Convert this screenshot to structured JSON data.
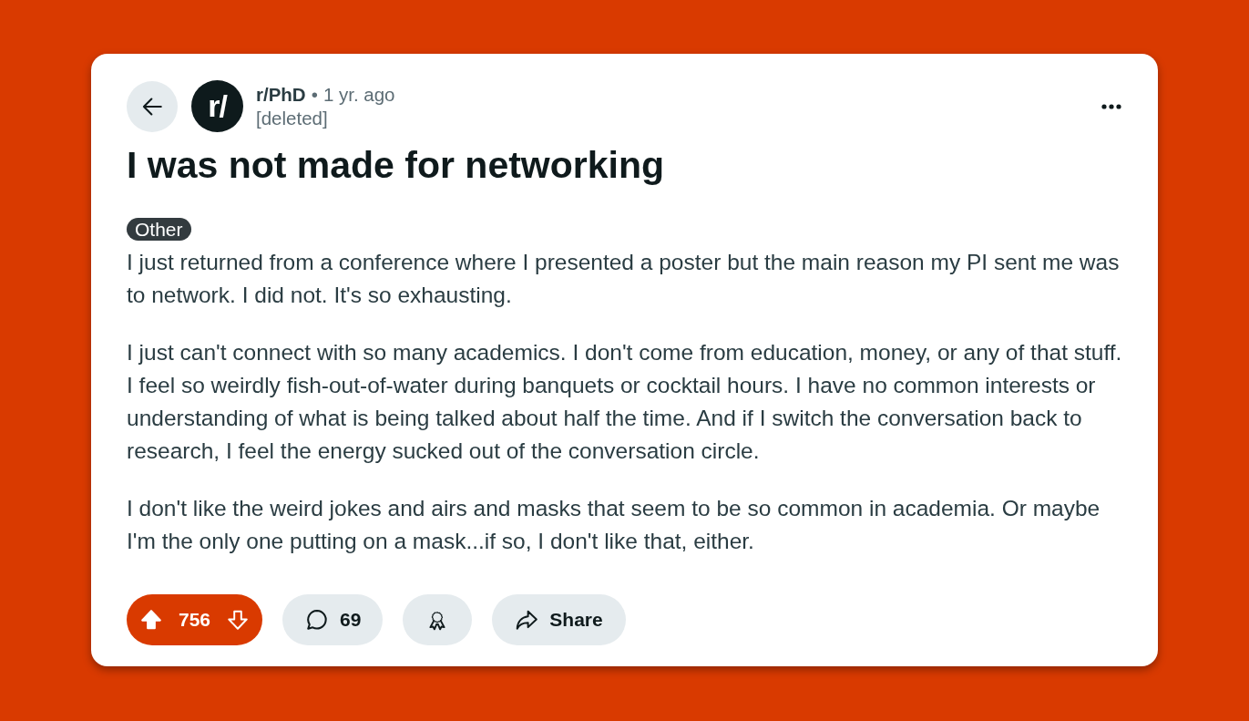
{
  "post": {
    "community": {
      "avatar_text": "r/",
      "name": "r/PhD"
    },
    "separator": "•",
    "age": "1 yr. ago",
    "author": "[deleted]",
    "title": "I was not made for networking",
    "flair": "Other",
    "body": [
      "I just returned from a conference where I presented a poster but the main reason my PI sent me was to network. I did not. It's so exhausting.",
      "I just can't connect with so many academics. I don't come from education, money, or any of that stuff. I feel so weirdly fish-out-of-water during banquets or cocktail hours. I have no common interests or understanding of what is being talked about half the time. And if I switch the conversation back to research, I feel the energy sucked out of the conversation circle.",
      "I don't like the weird jokes and airs and masks that seem to be so common in academia. Or maybe I'm the only one putting on a mask...if so, I don't like that, either."
    ]
  },
  "actions": {
    "upvoted": true,
    "score": "756",
    "comments": "69",
    "share": "Share"
  }
}
